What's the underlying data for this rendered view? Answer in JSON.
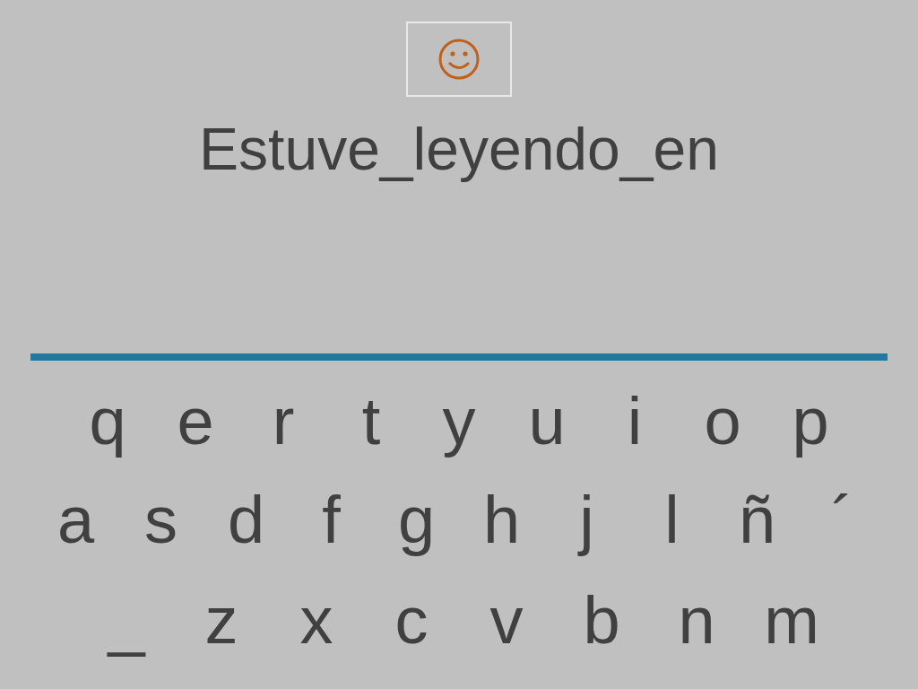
{
  "prompt": "Estuve_leyendo_en",
  "keyboard": {
    "rows": [
      {
        "keys": [
          "q",
          "e",
          "r",
          "t",
          "y",
          "u",
          "i",
          "o",
          "p"
        ]
      },
      {
        "keys": [
          "a",
          "s",
          "d",
          "f",
          "g",
          "h",
          "j",
          "l",
          "ñ",
          "´"
        ]
      },
      {
        "keys": [
          "_",
          "z",
          "x",
          "c",
          "v",
          "b",
          "n",
          "m"
        ]
      }
    ]
  }
}
